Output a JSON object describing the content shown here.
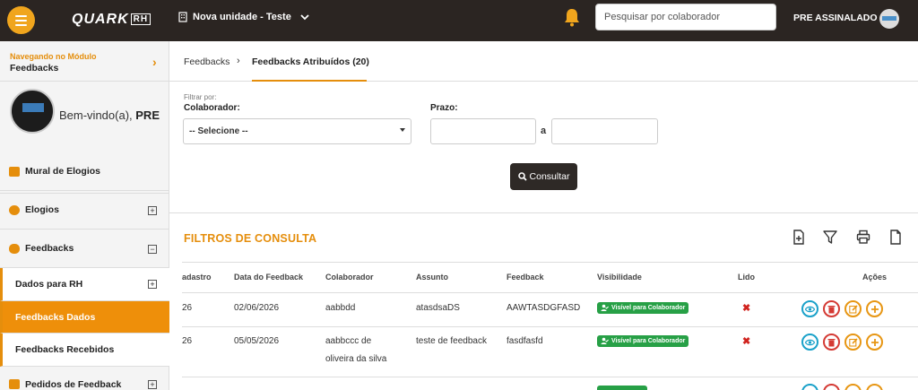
{
  "topbar": {
    "logo_main": "QUARK",
    "logo_suffix": "RH",
    "unit_label": "Nova unidade - Teste",
    "search_placeholder": "Pesquisar por colaborador",
    "user_name": "PRE ASSINALADO"
  },
  "sidebar": {
    "module_caption": "Navegando no Módulo",
    "module_name": "Feedbacks",
    "welcome_prefix": "Bem-vindo(a),",
    "welcome_name": "PRE",
    "items": [
      {
        "label": "Mural de Elogios"
      },
      {
        "label": "Elogios",
        "toggle": "+"
      },
      {
        "label": "Feedbacks",
        "toggle": "−"
      },
      {
        "label": "Dados para RH",
        "toggle": "+"
      },
      {
        "label": "Feedbacks Dados"
      },
      {
        "label": "Feedbacks Recebidos"
      },
      {
        "label": "Pedidos de Feedback",
        "toggle": "+"
      }
    ]
  },
  "breadcrumb": {
    "parent": "Feedbacks",
    "separator": "›",
    "current": "Feedbacks Atribuídos (20)"
  },
  "filters": {
    "caption": "Filtrar por:",
    "colaborador_label": "Colaborador:",
    "colaborador_value": "-- Selecione --",
    "prazo_label": "Prazo:",
    "range_sep": "a",
    "submit_label": "Consultar"
  },
  "results": {
    "title": "FILTROS DE CONSULTA",
    "columns": [
      "adastro",
      "Data do Feedback",
      "Colaborador",
      "Assunto",
      "Feedback",
      "Visibilidade",
      "Lido",
      "Ações"
    ],
    "rows": [
      {
        "cadastro": "26",
        "data": "02/06/2026",
        "colaborador_l1": "aabbdd",
        "colaborador_l2": "",
        "assunto": "atasdsaDS",
        "feedback": "AAWTASDGFASD",
        "visibilidade": "Visível para Colaborador",
        "lido": "✖"
      },
      {
        "cadastro": "26",
        "data": "05/05/2026",
        "colaborador_l1": "aabbccc de",
        "colaborador_l2": "oliveira da silva",
        "assunto": "teste de feedback",
        "feedback": "fasdfasfd",
        "visibilidade": "Visível para Colaborador",
        "lido": "✖"
      }
    ]
  },
  "colors": {
    "accent": "#e58e0c",
    "topbar": "#2b2522",
    "badge_green": "#27a046",
    "danger": "#d0231e"
  }
}
